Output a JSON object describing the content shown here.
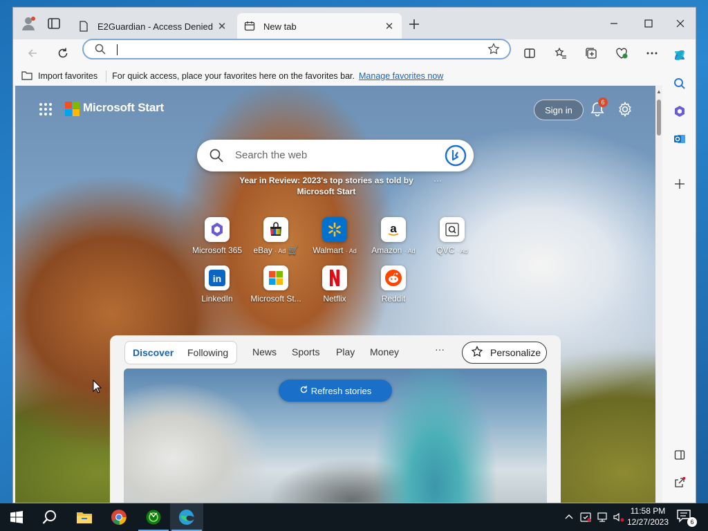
{
  "browser": {
    "tabs": [
      {
        "label": "E2Guardian - Access Denied",
        "active": false
      },
      {
        "label": "New tab",
        "active": true
      }
    ],
    "address": {
      "value": "",
      "placeholder": ""
    },
    "favorites_bar": {
      "import_label": "Import favorites",
      "quick_text": "For quick access, place your favorites here on the favorites bar.",
      "manage_link": "Manage favorites now"
    },
    "icons": {
      "back": "back-arrow-icon",
      "refresh": "refresh-icon",
      "search": "search-icon",
      "favorite": "star-icon",
      "split": "split-screen-icon",
      "favorites": "favorites-icon",
      "collections": "collections-icon",
      "performance": "heart-pulse-icon",
      "more": "more-icon",
      "copilot": "copilot-icon"
    }
  },
  "start_page": {
    "brand": "Microsoft Start",
    "sign_in": "Sign in",
    "notifications_count": "6",
    "search_placeholder": "Search the web",
    "year_in_review": "Year in Review: 2023's top stories as told by Microsoft Start",
    "year_more": "···",
    "quick_links": [
      {
        "label": "Microsoft 365",
        "ad": ""
      },
      {
        "label": "eBay",
        "ad": "· Ad"
      },
      {
        "label": "Walmart",
        "ad": "· Ad"
      },
      {
        "label": "Amazon",
        "ad": "· Ad"
      },
      {
        "label": "QVC",
        "ad": "· Ad"
      },
      {
        "label": "LinkedIn",
        "ad": ""
      },
      {
        "label": "Microsoft St...",
        "ad": ""
      },
      {
        "label": "Netflix",
        "ad": ""
      },
      {
        "label": "Reddit",
        "ad": ""
      }
    ],
    "feed": {
      "tabs": {
        "discover": "Discover",
        "following": "Following"
      },
      "nav": [
        "News",
        "Sports",
        "Play",
        "Money"
      ],
      "more": "···",
      "personalize": "Personalize",
      "refresh": "Refresh stories"
    }
  },
  "taskbar": {
    "apps": [
      "start-icon",
      "search-icon",
      "file-explorer-icon",
      "chrome-icon",
      "xbox-icon",
      "edge-icon"
    ],
    "time": "11:58 PM",
    "date": "12/27/2023",
    "notification_count": "6"
  },
  "colors": {
    "accent": "#1a6fc9",
    "discover": "#1a63b8",
    "badge": "#d94a2b",
    "taskbar": "#101820"
  }
}
